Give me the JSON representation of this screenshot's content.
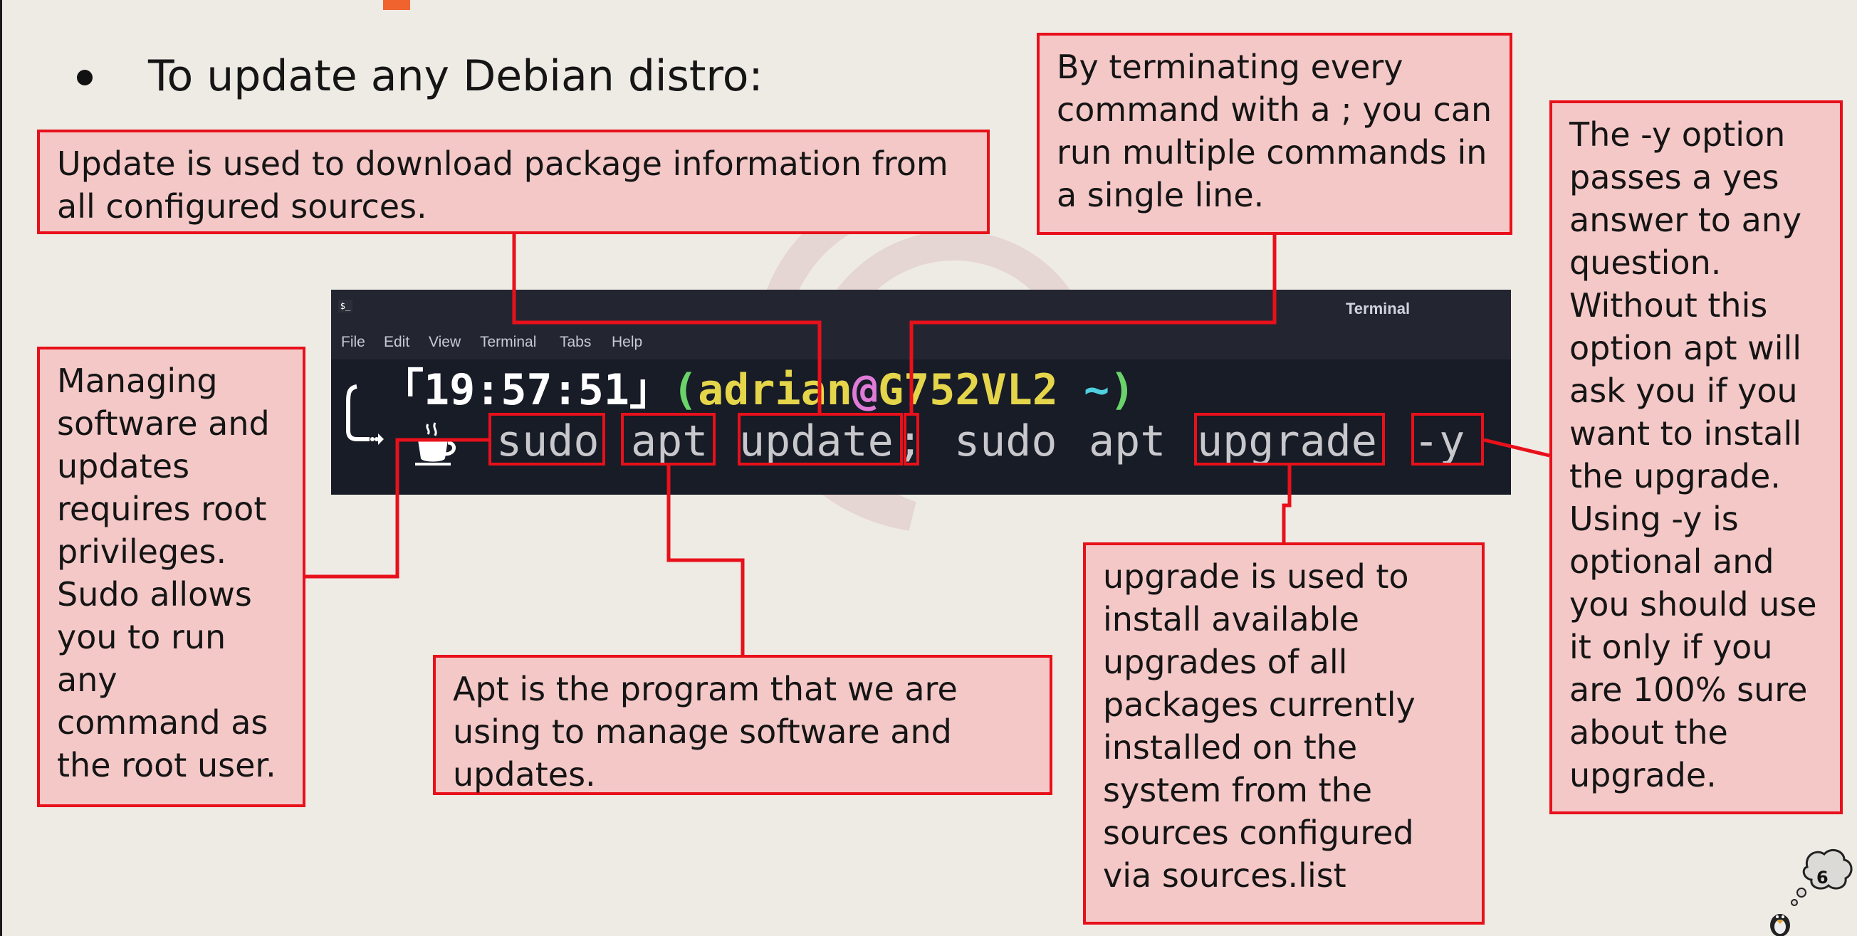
{
  "slide": {
    "heading": "To update any Debian distro:",
    "page_number": "6"
  },
  "terminal": {
    "icon_text": "$_",
    "title": "Terminal",
    "menu": [
      "File",
      "Edit",
      "View",
      "Terminal",
      "Tabs",
      "Help"
    ],
    "prompt": {
      "time": "「19:57:51」",
      "open_paren": "(",
      "user": "adrian",
      "at": "@",
      "host": "G752VL2",
      "tilde": " ~",
      "close_paren": ")"
    },
    "command": {
      "tokens": [
        "sudo",
        "apt",
        "update",
        ";",
        "sudo",
        "apt",
        "upgrade",
        "-y"
      ]
    }
  },
  "callouts": {
    "update": "Update is used to download package information from all configured sources.",
    "semicolon": "By terminating every command with a ; you can run multiple commands in a single line.",
    "yes_option": "The -y option passes a yes answer to any question. Without this option apt will ask you if you want to install the upgrade. Using -y is optional and you should use it only if you are 100% sure about the upgrade.",
    "sudo": "Managing software and updates requires root privileges. Sudo allows you to run any command as the root user.",
    "apt": "Apt is the program that we are using to manage software and updates.",
    "upgrade": "upgrade is used to install available upgrades of all packages currently installed on the system from the sources configured via sources.list"
  },
  "colors": {
    "background": "#eeebe5",
    "callout_fill": "#f5c8c8",
    "callout_border": "#e8101a",
    "terminal_bg": "#171c27",
    "prompt_time": "#ffffff",
    "prompt_paren": "#6ad36a",
    "prompt_user": "#e5d54a",
    "prompt_host": "#e5d54a",
    "prompt_tilde": "#4fd0e0"
  },
  "icons": {
    "prompt_arrow": "corner-arrow-icon",
    "prompt_cup": "coffee-cup-icon",
    "mascot": "penguin-thought-bubble-icon"
  }
}
